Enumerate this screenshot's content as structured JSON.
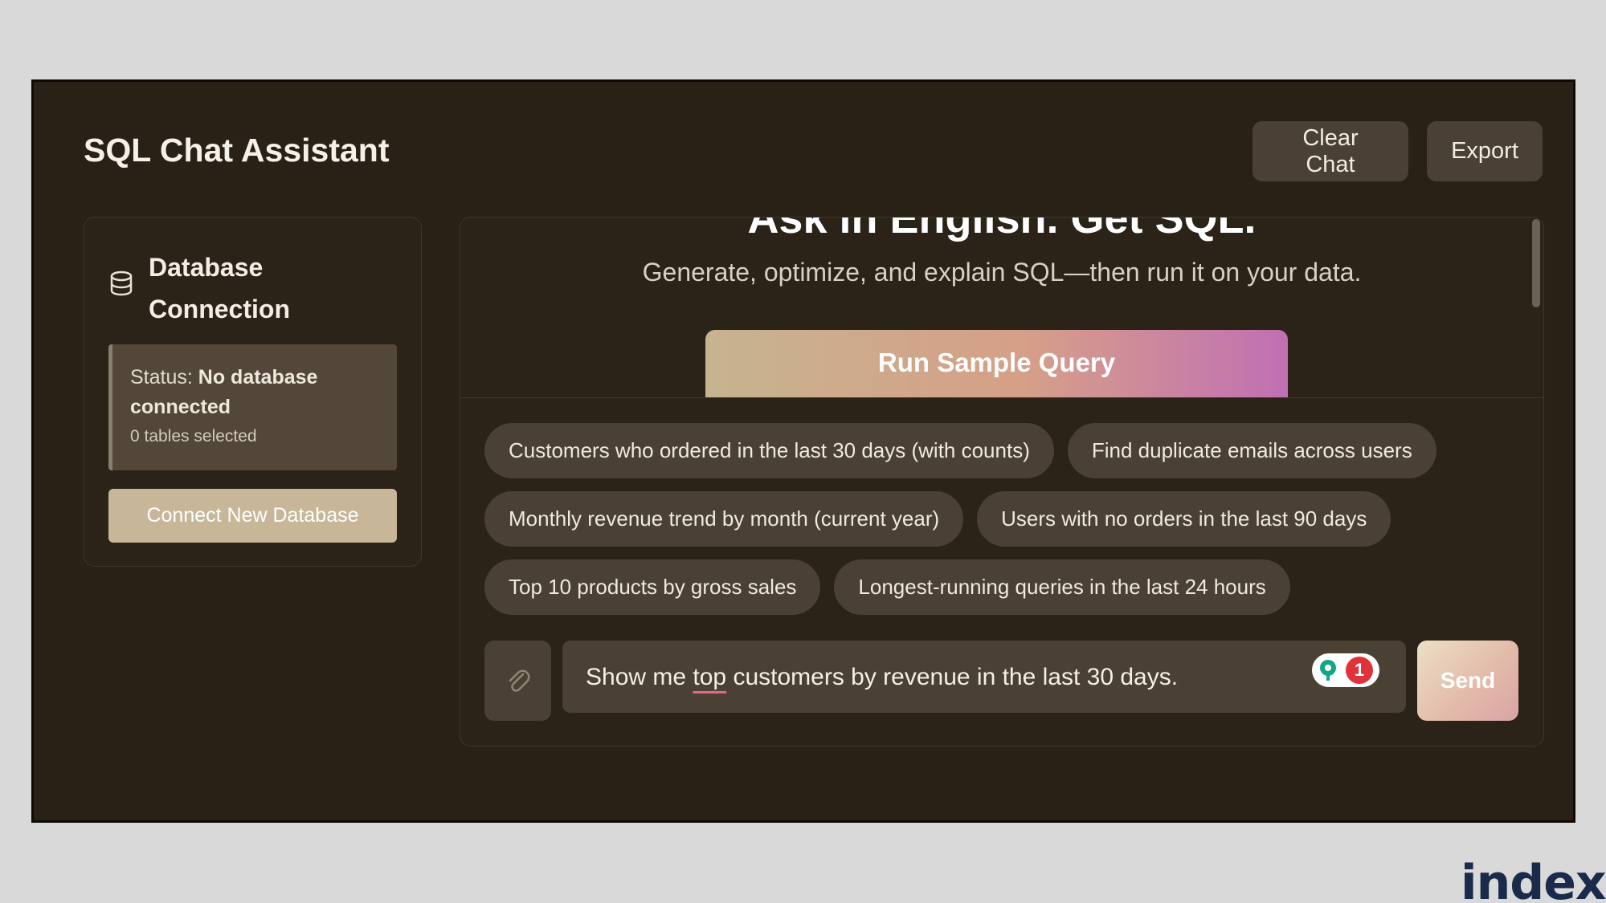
{
  "header": {
    "title": "SQL Chat Assistant",
    "clear_label": "Clear Chat",
    "export_label": "Export"
  },
  "sidebar": {
    "title": "Database Connection",
    "status_prefix": "Status:",
    "status_value": "No database connected",
    "tables": "0 tables selected",
    "connect_label": "Connect New Database"
  },
  "hero": {
    "heading": "Ask in English. Get SQL.",
    "subtitle": "Generate, optimize, and explain SQL—then run it on your data.",
    "run_label": "Run Sample Query"
  },
  "suggestions": [
    "Customers who ordered in the last 30 days (with counts)",
    "Find duplicate emails across users",
    "Monthly revenue trend by month (current year)",
    "Users with no orders in the last 90 days",
    "Top 10 products by gross sales",
    "Longest-running queries in the last 24 hours"
  ],
  "composer": {
    "text_before": "Show me ",
    "text_flagged": "top",
    "text_after": " customers by revenue in the last 30 days.",
    "issue_count": "1",
    "send_label": "Send"
  },
  "brand": {
    "text": "index",
    "dot": "."
  },
  "colors": {
    "background": "#2a2116",
    "chip": "#4a4134",
    "accent_gradient": [
      "#c6b48f",
      "#d69f88",
      "#c06fb4"
    ]
  },
  "icons": {
    "database": "database-icon",
    "attach": "paperclip-icon",
    "grammar": "lightbulb-icon"
  }
}
